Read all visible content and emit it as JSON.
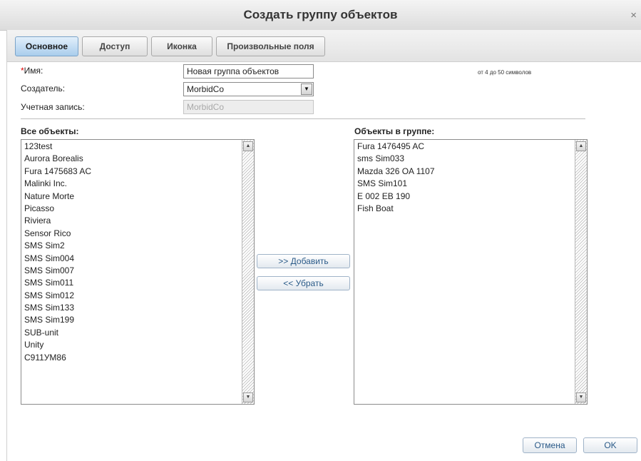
{
  "dialog": {
    "title": "Создать группу объектов",
    "close_glyph": "×"
  },
  "tabs": [
    {
      "label": "Основное",
      "active": true
    },
    {
      "label": "Доступ",
      "active": false
    },
    {
      "label": "Иконка",
      "active": false
    },
    {
      "label": "Произвольные поля",
      "active": false
    }
  ],
  "form": {
    "required_mark": "*",
    "name_label": "Имя:",
    "name_value": "Новая группа объектов",
    "name_hint": "от 4 до 50 символов",
    "creator_label": "Создатель:",
    "creator_value": "MorbidCo",
    "account_label": "Учетная запись:",
    "account_value": "MorbidCo"
  },
  "all_objects": {
    "header": "Все объекты:",
    "items": [
      "123test",
      "Aurora Borealis",
      "Fura 1475683 AC",
      "Malinki Inc.",
      "Nature Morte",
      "Picasso",
      "Riviera",
      "Sensor Rico",
      "SMS Sim2",
      "SMS Sim004",
      "SMS Sim007",
      "SMS Sim011",
      "SMS Sim012",
      "SMS Sim133",
      "SMS Sim199",
      "SUB-unit",
      "Unity",
      "С911УМ86"
    ]
  },
  "group_objects": {
    "header": "Объекты в группе:",
    "items": [
      "Fura 1476495 AC",
      "sms Sim033",
      "Mazda 326 OA 1107",
      "SMS Sim101",
      "E 002 EB 190",
      "Fish Boat"
    ]
  },
  "actions": {
    "add_label": ">> Добавить",
    "remove_label": "<< Убрать"
  },
  "footer": {
    "cancel_label": "Отмена",
    "ok_label": "OK"
  },
  "icons": {
    "scroll_up": "▲",
    "scroll_down": "▼",
    "dropdown": "▼"
  },
  "colors": {
    "active_tab": "#a9cdec",
    "required": "#e00000",
    "button_text": "#2a5a88"
  }
}
